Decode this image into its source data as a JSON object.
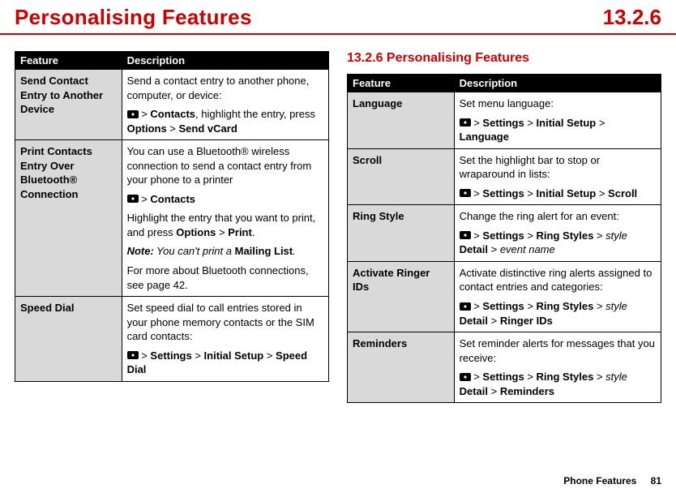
{
  "header": {
    "title": "Personalising Features",
    "section": "13.2.6"
  },
  "left": {
    "th_feature": "Feature",
    "th_desc": "Description",
    "rows": [
      {
        "name": "Send Contact Entry to Another Device",
        "desc1": "Send a contact entry to another phone, computer, or device:",
        "path_a": "Contacts",
        "desc2a": ", highlight the entry, press ",
        "path_b": "Options",
        "gt1": " > ",
        "path_c": "Send vCard"
      },
      {
        "name": "Print Contacts Entry Over Bluetooth® Connection",
        "desc1": "You can use a Bluetooth® wireless connection to send a contact entry from your phone to a printer",
        "path_a": "Contacts",
        "desc2": "Highlight the entry that you want to print, and press ",
        "path_b": "Options",
        "gt1": " > ",
        "path_c": "Print",
        "desc2_tail": ".",
        "note_label": "Note:",
        "note_text": " You can't print a ",
        "note_menu": "Mailing List",
        "note_tail": ".",
        "desc3": "For more about Bluetooth connections, see page 42."
      },
      {
        "name": "Speed Dial",
        "desc1": "Set speed dial to call entries stored in your phone memory contacts or the SIM card contacts:",
        "gt": " > ",
        "path_a": "Settings",
        "path_b": "Initial Setup",
        "path_c": "Speed Dial"
      }
    ]
  },
  "right": {
    "subhead": "13.2.6 Personalising Features",
    "th_feature": "Feature",
    "th_desc": "Description",
    "rows": [
      {
        "name": "Language",
        "desc1": "Set menu language:",
        "gt": " > ",
        "path_a": "Settings",
        "path_b": "Initial Setup",
        "path_c": "Language"
      },
      {
        "name": "Scroll",
        "desc1": "Set the highlight bar to stop or wraparound in lists:",
        "gt": " > ",
        "path_a": "Settings",
        "path_b": "Initial Setup",
        "path_c": "Scroll"
      },
      {
        "name": "Ring Style",
        "desc1": "Change the ring alert for an event:",
        "gt": " > ",
        "path_a": "Settings",
        "path_b": "Ring Styles",
        "style_word": "style",
        "path_c": " Detail",
        "tail_gt": " > ",
        "tail_italic": "event name"
      },
      {
        "name": "Activate Ringer IDs",
        "desc1": "Activate distinctive ring alerts assigned to contact entries and categories:",
        "gt": " > ",
        "path_a": "Settings",
        "path_b": "Ring Styles",
        "style_word": "style",
        "path_c": " Detail",
        "tail_gt": " > ",
        "tail_menu": "Ringer IDs"
      },
      {
        "name": "Reminders",
        "desc1": "Set reminder alerts for messages that you receive:",
        "gt": " > ",
        "path_a": "Settings",
        "path_b": "Ring Styles",
        "style_word": "style",
        "path_c": " Detail",
        "tail_gt": " > ",
        "tail_menu": "Reminders"
      }
    ]
  },
  "footer": {
    "label": "Phone Features",
    "page": "81"
  }
}
